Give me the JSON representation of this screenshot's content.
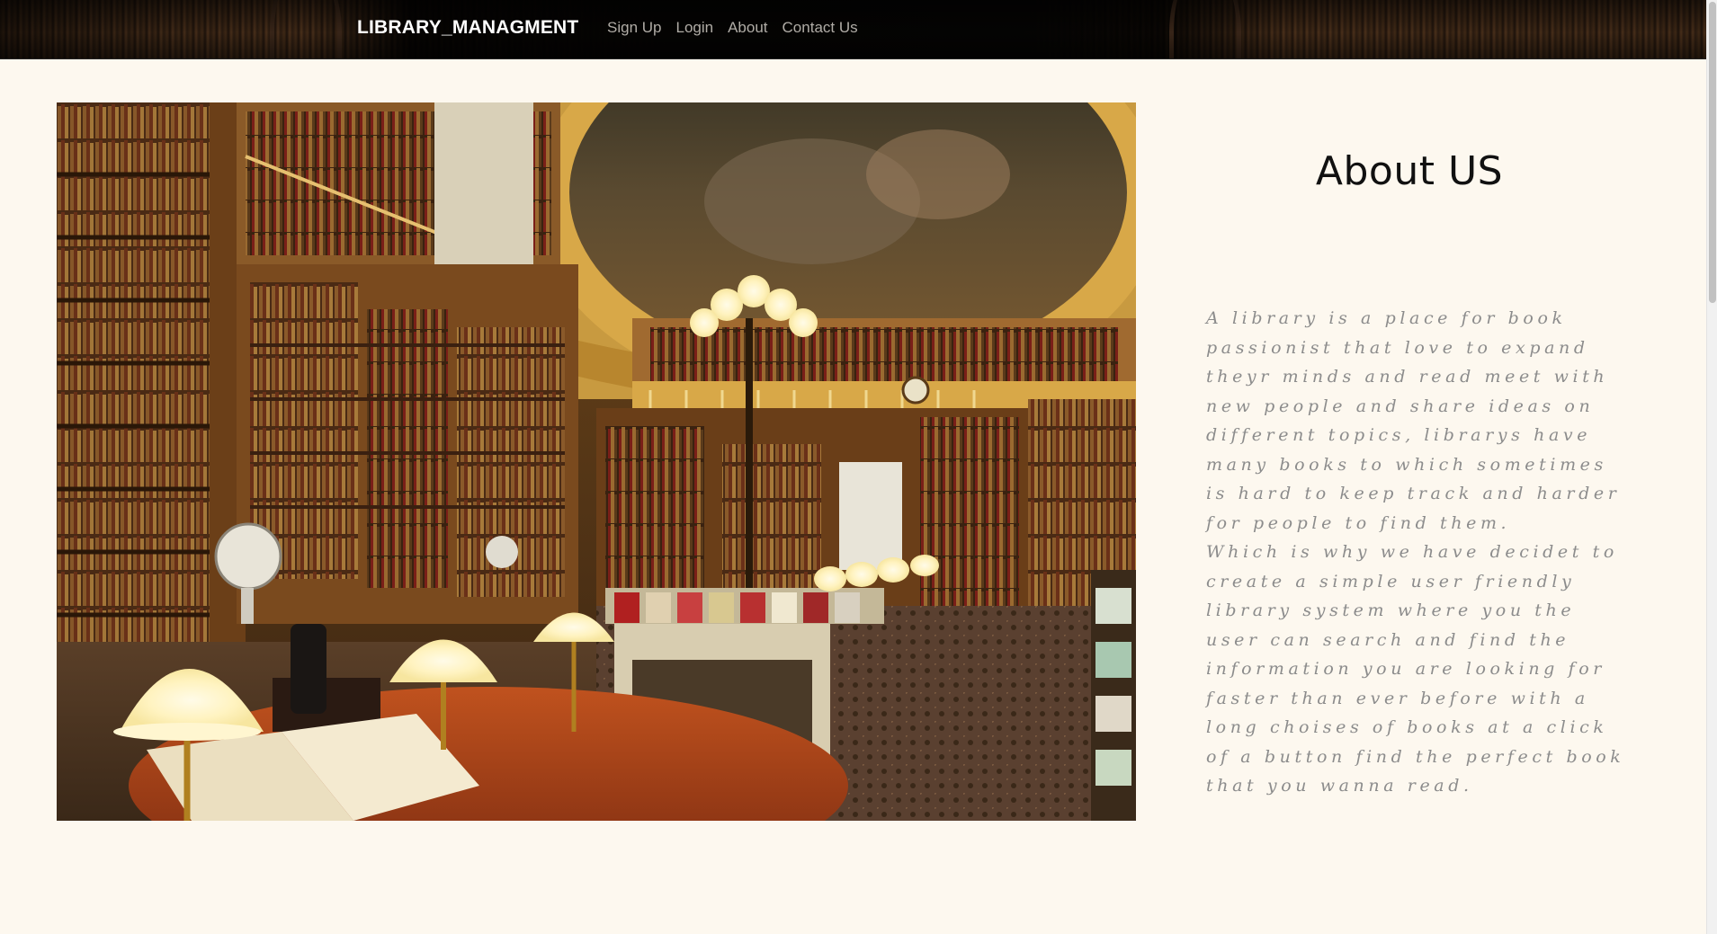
{
  "navbar": {
    "brand": "LIBRARY_MANAGMENT",
    "links": [
      {
        "label": "Sign Up"
      },
      {
        "label": "Login"
      },
      {
        "label": "About"
      },
      {
        "label": "Contact Us"
      }
    ]
  },
  "about": {
    "title": "About US",
    "paragraph_1": "A library is a place for book passionist that love to expand theyr minds and read meet with new people and share ideas on different topics, librarys have many books to which sometimes is hard to keep track and harder for people to find them.",
    "paragraph_2": "Which is why we have decidet to create a simple user friendly library system where you the user can search and find the information you are looking for faster than ever before with a long choises of books at a click of a button find the perfect book that you wanna read."
  },
  "hero_image": {
    "icon": "library-reading-room-photo"
  },
  "colors": {
    "page_background": "#fdf8ef",
    "navbar_background": "#0a0806",
    "brand_text": "#ffffff",
    "nav_link_text": "#b0aca6",
    "title_text": "#111111",
    "body_text": "#8c8c8c"
  }
}
